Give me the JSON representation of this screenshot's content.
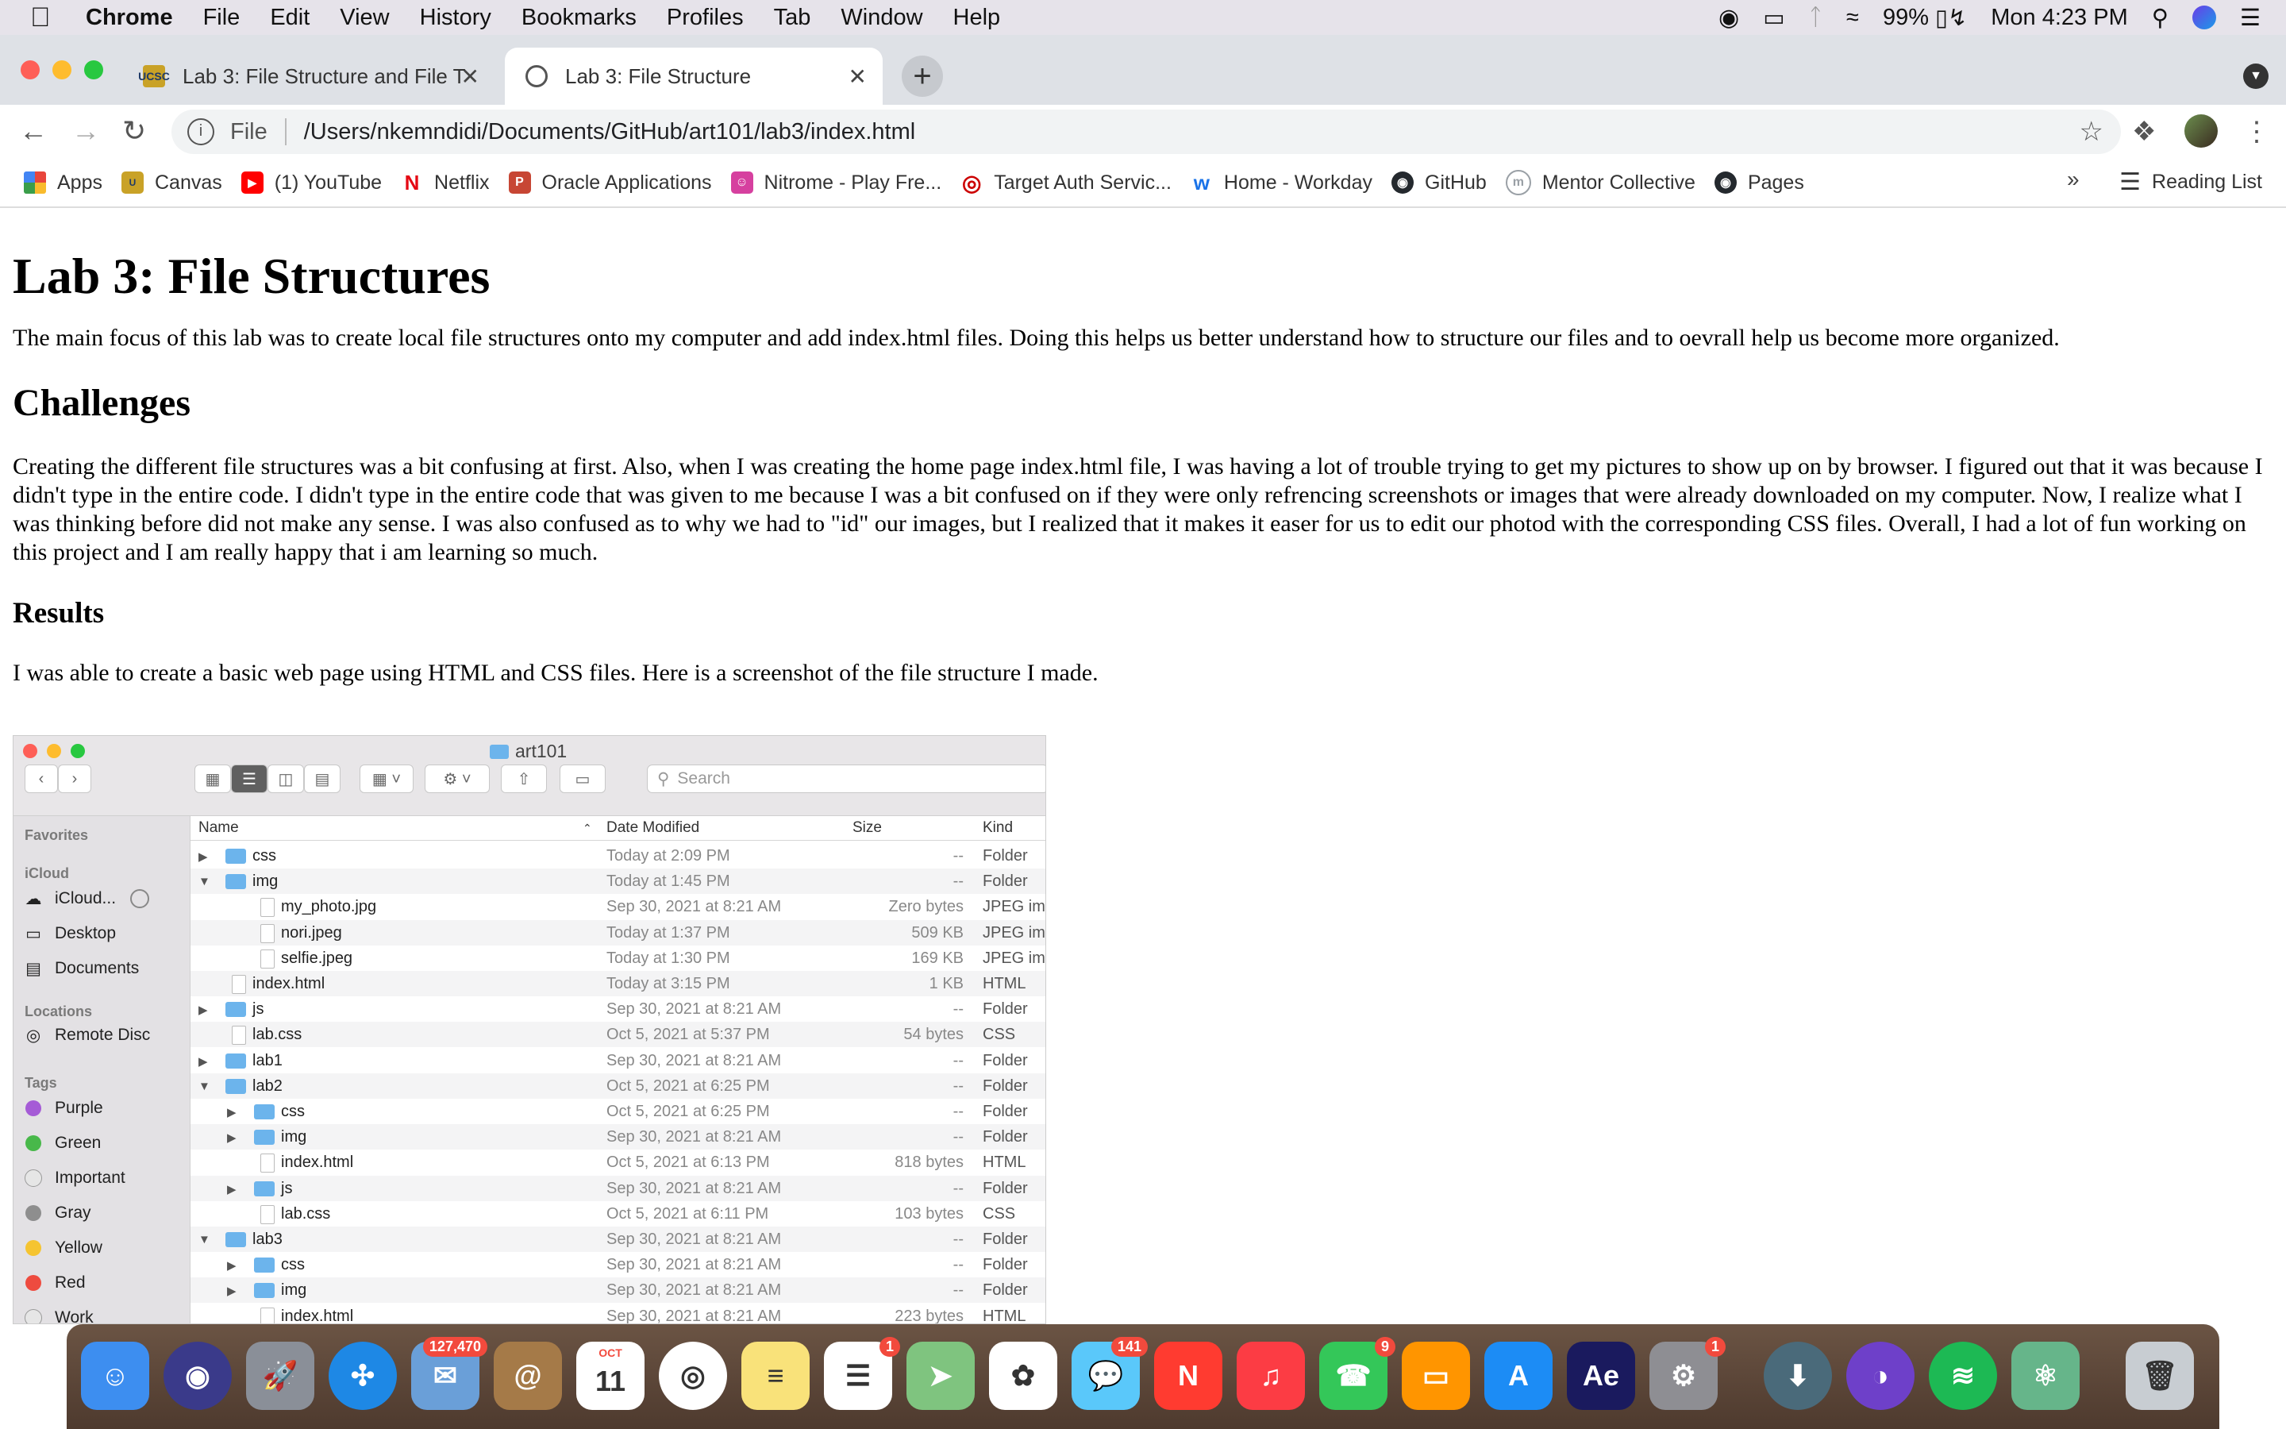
{
  "menubar": {
    "app": "Chrome",
    "items": [
      "File",
      "Edit",
      "View",
      "History",
      "Bookmarks",
      "Profiles",
      "Tab",
      "Window",
      "Help"
    ],
    "battery": "99%",
    "clock": "Mon 4:23 PM"
  },
  "tabs": [
    {
      "title": "Lab 3: File Structure and File T",
      "favicon": "UCSC"
    },
    {
      "title": "Lab 3: File Structure"
    }
  ],
  "address": {
    "scheme": "File",
    "url": "/Users/nkemndidi/Documents/GitHub/art101/lab3/index.html"
  },
  "bookmarks": [
    {
      "label": "Apps",
      "icon": "apps-grid-icon",
      "color": "#e8453c"
    },
    {
      "label": "Canvas",
      "icon": "ucsc-icon",
      "color": "#c9a227"
    },
    {
      "label": "(1) YouTube",
      "icon": "youtube-icon",
      "color": "#ff0000"
    },
    {
      "label": "Netflix",
      "icon": "netflix-icon",
      "color": "#e50914"
    },
    {
      "label": "Oracle Applications",
      "icon": "oracle-icon",
      "color": "#c74634"
    },
    {
      "label": "Nitrome - Play Fre...",
      "icon": "nitrome-icon",
      "color": "#d6409f"
    },
    {
      "label": "Target Auth Servic...",
      "icon": "target-icon",
      "color": "#cc0000"
    },
    {
      "label": "Home - Workday",
      "icon": "workday-icon",
      "color": "#f5a623"
    },
    {
      "label": "GitHub",
      "icon": "github-icon",
      "color": "#24292e"
    },
    {
      "label": "Mentor Collective",
      "icon": "mentor-icon",
      "color": "#9aa0a6"
    },
    {
      "label": "Pages",
      "icon": "github-icon",
      "color": "#24292e"
    }
  ],
  "bookmarks_more": "»",
  "reading_list": "Reading List",
  "page": {
    "h1": "Lab 3: File Structures",
    "intro": "The main focus of this lab was to create local file structures onto my computer and add index.html files. Doing this helps us better understand how to structure our files and to oevrall help us become more organized.",
    "h2": "Challenges",
    "challenges": "Creating the different file structures was a bit confusing at first. Also, when I was creating the home page index.html file, I was having a lot of trouble trying to get my pictures to show up on by browser. I figured out that it was because I didn't type in the entire code. I didn't type in the entire code that was given to me because I was a bit confused on if they were only refrencing screenshots or images that were already downloaded on my computer. Now, I realize what I was thinking before did not make any sense. I was also confused as to why we had to \"id\" our images, but I realized that it makes it easer for us to edit our photod with the corresponding CSS files. Overall, I had a lot of fun working on this project and I am really happy that i am learning so much.",
    "h3": "Results",
    "results": "I was able to create a basic web page using HTML and CSS files. Here is a screenshot of the file structure I made."
  },
  "finder": {
    "title": "art101",
    "search_placeholder": "Search",
    "sidebar": {
      "favorites": "Favorites",
      "icloud": "iCloud",
      "icloud_drive": "iCloud...",
      "desktop": "Desktop",
      "documents": "Documents",
      "locations": "Locations",
      "remote_disc": "Remote Disc",
      "tags_header": "Tags",
      "tags": [
        {
          "name": "Purple",
          "color": "#a55bd6"
        },
        {
          "name": "Green",
          "color": "#48b84a"
        },
        {
          "name": "Important",
          "color": "#e6e6e6"
        },
        {
          "name": "Gray",
          "color": "#8e8e8e"
        },
        {
          "name": "Yellow",
          "color": "#f5c431"
        },
        {
          "name": "Red",
          "color": "#ee4b3f"
        },
        {
          "name": "Work",
          "color": "#e6e6e6"
        }
      ]
    },
    "columns": {
      "name": "Name",
      "date": "Date Modified",
      "size": "Size",
      "kind": "Kind"
    },
    "rows": [
      {
        "name": "css",
        "date": "Today at 2:09 PM",
        "size": "--",
        "kind": "Folder",
        "level": 0,
        "type": "folder",
        "tri": "▶"
      },
      {
        "name": "img",
        "date": "Today at 1:45 PM",
        "size": "--",
        "kind": "Folder",
        "level": 0,
        "type": "folder",
        "tri": "▼"
      },
      {
        "name": "my_photo.jpg",
        "date": "Sep 30, 2021 at 8:21 AM",
        "size": "Zero bytes",
        "kind": "JPEG ima",
        "level": 1,
        "type": "file",
        "tri": ""
      },
      {
        "name": "nori.jpeg",
        "date": "Today at 1:37 PM",
        "size": "509 KB",
        "kind": "JPEG ima",
        "level": 1,
        "type": "file",
        "tri": ""
      },
      {
        "name": "selfie.jpeg",
        "date": "Today at 1:30 PM",
        "size": "169 KB",
        "kind": "JPEG ima",
        "level": 1,
        "type": "file",
        "tri": ""
      },
      {
        "name": "index.html",
        "date": "Today at 3:15 PM",
        "size": "1 KB",
        "kind": "HTML",
        "level": 0,
        "type": "file",
        "tri": ""
      },
      {
        "name": "js",
        "date": "Sep 30, 2021 at 8:21 AM",
        "size": "--",
        "kind": "Folder",
        "level": 0,
        "type": "folder",
        "tri": "▶"
      },
      {
        "name": "lab.css",
        "date": "Oct 5, 2021 at 5:37 PM",
        "size": "54 bytes",
        "kind": "CSS",
        "level": 0,
        "type": "file",
        "tri": ""
      },
      {
        "name": "lab1",
        "date": "Sep 30, 2021 at 8:21 AM",
        "size": "--",
        "kind": "Folder",
        "level": 0,
        "type": "folder",
        "tri": "▶"
      },
      {
        "name": "lab2",
        "date": "Oct 5, 2021 at 6:25 PM",
        "size": "--",
        "kind": "Folder",
        "level": 0,
        "type": "folder",
        "tri": "▼"
      },
      {
        "name": "css",
        "date": "Oct 5, 2021 at 6:25 PM",
        "size": "--",
        "kind": "Folder",
        "level": 1,
        "type": "folder",
        "tri": "▶"
      },
      {
        "name": "img",
        "date": "Sep 30, 2021 at 8:21 AM",
        "size": "--",
        "kind": "Folder",
        "level": 1,
        "type": "folder",
        "tri": "▶"
      },
      {
        "name": "index.html",
        "date": "Oct 5, 2021 at 6:13 PM",
        "size": "818 bytes",
        "kind": "HTML",
        "level": 1,
        "type": "file",
        "tri": ""
      },
      {
        "name": "js",
        "date": "Sep 30, 2021 at 8:21 AM",
        "size": "--",
        "kind": "Folder",
        "level": 1,
        "type": "folder",
        "tri": "▶"
      },
      {
        "name": "lab.css",
        "date": "Oct 5, 2021 at 6:11 PM",
        "size": "103 bytes",
        "kind": "CSS",
        "level": 1,
        "type": "file",
        "tri": ""
      },
      {
        "name": "lab3",
        "date": "Sep 30, 2021 at 8:21 AM",
        "size": "--",
        "kind": "Folder",
        "level": 0,
        "type": "folder",
        "tri": "▼"
      },
      {
        "name": "css",
        "date": "Sep 30, 2021 at 8:21 AM",
        "size": "--",
        "kind": "Folder",
        "level": 1,
        "type": "folder",
        "tri": "▶"
      },
      {
        "name": "img",
        "date": "Sep 30, 2021 at 8:21 AM",
        "size": "--",
        "kind": "Folder",
        "level": 1,
        "type": "folder",
        "tri": "▶"
      },
      {
        "name": "index.html",
        "date": "Sep 30, 2021 at 8:21 AM",
        "size": "223 bytes",
        "kind": "HTML",
        "level": 1,
        "type": "file",
        "tri": ""
      }
    ]
  },
  "dock": {
    "apps": [
      {
        "name": "finder",
        "color": "#3d8ef0",
        "glyph": "☺"
      },
      {
        "name": "siri",
        "color": "#3a3a8a",
        "glyph": "◉"
      },
      {
        "name": "launchpad",
        "color": "#8a8f98",
        "glyph": "🚀"
      },
      {
        "name": "safari",
        "color": "#1e88e5",
        "glyph": "✣"
      },
      {
        "name": "mail",
        "color": "#6a9fd8",
        "glyph": "✉",
        "badge": "127,470"
      },
      {
        "name": "contacts",
        "color": "#a57a48",
        "glyph": "@"
      },
      {
        "name": "calendar",
        "color": "#ffffff",
        "glyph": "11",
        "label": "OCT"
      },
      {
        "name": "chrome",
        "color": "#ffffff",
        "glyph": "◎"
      },
      {
        "name": "notes",
        "color": "#f9e27a",
        "glyph": "≡"
      },
      {
        "name": "reminders",
        "color": "#ffffff",
        "glyph": "☰",
        "badge": "1"
      },
      {
        "name": "maps",
        "color": "#7fc47f",
        "glyph": "➤"
      },
      {
        "name": "photos",
        "color": "#ffffff",
        "glyph": "✿"
      },
      {
        "name": "messages",
        "color": "#5ac8fa",
        "glyph": "💬",
        "badge": "141"
      },
      {
        "name": "news",
        "color": "#ff3b30",
        "glyph": "N"
      },
      {
        "name": "music",
        "color": "#fc3c44",
        "glyph": "♫"
      },
      {
        "name": "facetime",
        "color": "#34c759",
        "glyph": "☎",
        "badge": "9"
      },
      {
        "name": "books",
        "color": "#ff9500",
        "glyph": "▭"
      },
      {
        "name": "app-store",
        "color": "#1c8cf5",
        "glyph": "A"
      },
      {
        "name": "after-effects",
        "color": "#1a1a5e",
        "glyph": "Ae"
      },
      {
        "name": "system-preferences",
        "color": "#8e8e93",
        "glyph": "⚙",
        "badge": "1"
      },
      {
        "name": "downloads",
        "color": "#4a6a7a",
        "glyph": "⬇"
      },
      {
        "name": "github-desktop",
        "color": "#6e40c9",
        "glyph": "◑"
      },
      {
        "name": "spotify",
        "color": "#1db954",
        "glyph": "≋"
      },
      {
        "name": "atom",
        "color": "#66b58a",
        "glyph": "⚛"
      },
      {
        "name": "trash",
        "color": "#c8cdd2",
        "glyph": "🗑"
      }
    ]
  }
}
